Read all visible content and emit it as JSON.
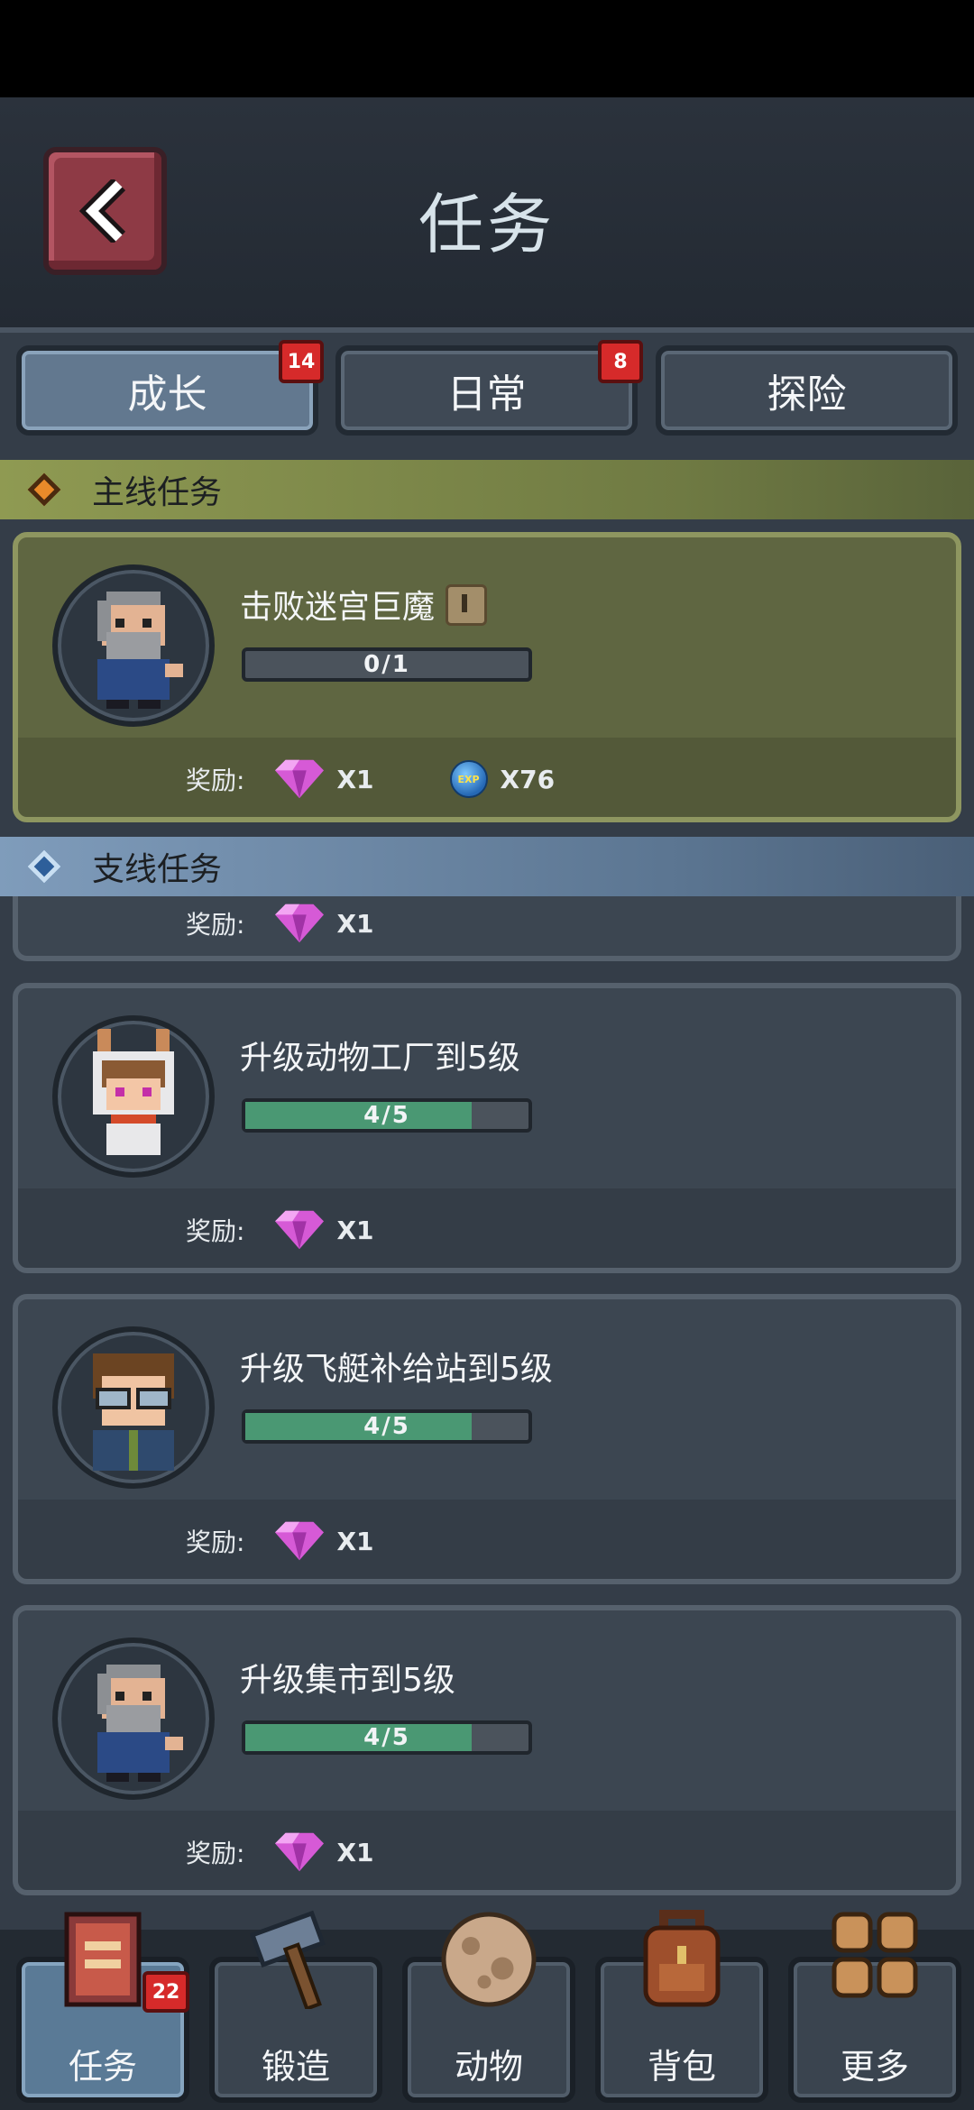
{
  "header": {
    "title": "任务"
  },
  "tabs": [
    {
      "label": "成长",
      "badge": "14",
      "active": true
    },
    {
      "label": "日常",
      "badge": "8",
      "active": false
    },
    {
      "label": "探险",
      "badge": "",
      "active": false
    }
  ],
  "sections": {
    "main": "主线任务",
    "side": "支线任务"
  },
  "reward_label": "奖励:",
  "main_quest": {
    "title": "击败迷宫巨魔",
    "progress_text": "0/1",
    "progress": 0,
    "rewards": {
      "gem_qty": "X1",
      "exp_qty": "X76",
      "exp_icon_text": "EXP"
    }
  },
  "partial_quest": {
    "gem_qty": "X1"
  },
  "side_quests": [
    {
      "title": "升级动物工厂到5级",
      "progress_text": "4/5",
      "progress": 0.8,
      "gem_qty": "X1",
      "avatar": "bunny-hood-girl"
    },
    {
      "title": "升级飞艇补给站到5级",
      "progress_text": "4/5",
      "progress": 0.8,
      "gem_qty": "X1",
      "avatar": "glasses-boy"
    },
    {
      "title": "升级集市到5级",
      "progress_text": "4/5",
      "progress": 0.8,
      "gem_qty": "X1",
      "avatar": "old-wizard"
    }
  ],
  "nav": [
    {
      "label": "任务",
      "icon": "quest-book-icon",
      "badge": "22",
      "active": true
    },
    {
      "label": "锻造",
      "icon": "hammer-icon",
      "badge": "",
      "active": false
    },
    {
      "label": "动物",
      "icon": "egg-icon",
      "badge": "",
      "active": false
    },
    {
      "label": "背包",
      "icon": "backpack-icon",
      "badge": "",
      "active": false
    },
    {
      "label": "更多",
      "icon": "grid-more-icon",
      "badge": "",
      "active": false
    }
  ],
  "colors": {
    "progress_fill": "#4a9873",
    "badge_red": "#d62a2a",
    "gem": "#d65ad6"
  }
}
